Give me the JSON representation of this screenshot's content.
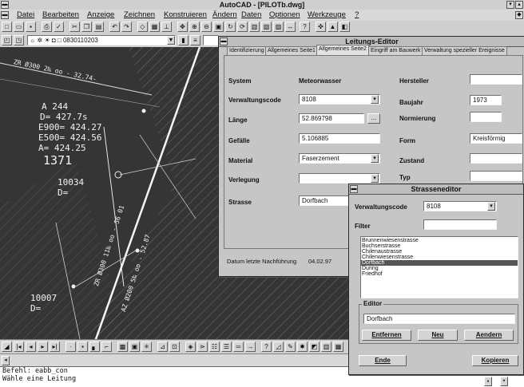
{
  "window": {
    "title": "AutoCAD - [PILOTb.dwg]"
  },
  "menu": [
    "Datei",
    "Bearbeiten",
    "Anzeige",
    "Zeichnen",
    "Konstruieren",
    "Ändern",
    "Daten",
    "Optionen",
    "Werkzeuge",
    "?"
  ],
  "toolbar2": {
    "layer_value": "0830110203"
  },
  "drawing": {
    "labels": {
      "top_angle": "ZR Ø300 2‰ oo - 32.74-",
      "a": "A 244",
      "d": "D= 427.7s",
      "e900": "E900= 424.27",
      "e500": "E500= 424.56",
      "a2": "A= 424.25",
      "big": "1371",
      "n1": "10034",
      "d2": "D=",
      "n2": "10007",
      "d3": "D=",
      "pipe1": "ZR Ø300 11‰ oo - 56 01",
      "pipe2": "AZ Ø200 5‰ oo - 52.87"
    }
  },
  "leitungs_editor": {
    "title": "Leitungs-Editor",
    "tabs": [
      "Identifizierung",
      "Allgemeines Seite1",
      "Allgemeines Seite2",
      "Eingriff am Bauwerk",
      "Verwaltung spezieller Ereignisse"
    ],
    "system_label": "System",
    "system_value": "Meteorwasser",
    "verwaltungscode_label": "Verwaltungscode",
    "verwaltungscode_value": "8108",
    "laenge_label": "Länge",
    "laenge_value": "52.869798",
    "laenge_button": "...",
    "gefaelle_label": "Gefälle",
    "gefaelle_value": "5.106885",
    "material_label": "Material",
    "material_value": "Faserzement",
    "verlegung_label": "Verlegung",
    "verlegung_value": "",
    "strasse_label": "Strasse",
    "strasse_value": "Dorfbach",
    "hersteller_label": "Hersteller",
    "hersteller_value": "",
    "baujahr_label": "Baujahr",
    "baujahr_value": "1973",
    "normierung_label": "Normierung",
    "normierung_value": "",
    "form_label": "Form",
    "form_value": "Kreisförmig",
    "zustand_label": "Zustand",
    "zustand_value": "",
    "typ_label": "Typ",
    "typ_value": "",
    "nachfuehrung_label": "Datum letzte Nachführung",
    "nachfuehrung_value": "04.02.97"
  },
  "strassen_editor": {
    "title": "Strasseneditor",
    "verwaltungscode_label": "Verwaltungscode",
    "verwaltungscode_value": "8108",
    "filter_label": "Filter",
    "filter_value": "",
    "list": [
      "Brunnenwiesenstrasse",
      "Buchserstrasse",
      "Chilenaustrasse",
      "Chilenwiesenstrasse",
      "Dorfbach",
      "During",
      "Friedhof"
    ],
    "selected": "Dorfbach",
    "editor_label": "Editor",
    "editor_value": "Dorfbach",
    "buttons": {
      "entfernen": "Entfernen",
      "neu": "Neu",
      "aendern": "Aendern",
      "ende": "Ende",
      "kopieren": "Kopieren"
    }
  },
  "command_line": [
    "Befehl: eabb_con",
    "Wähle eine Leitung"
  ]
}
